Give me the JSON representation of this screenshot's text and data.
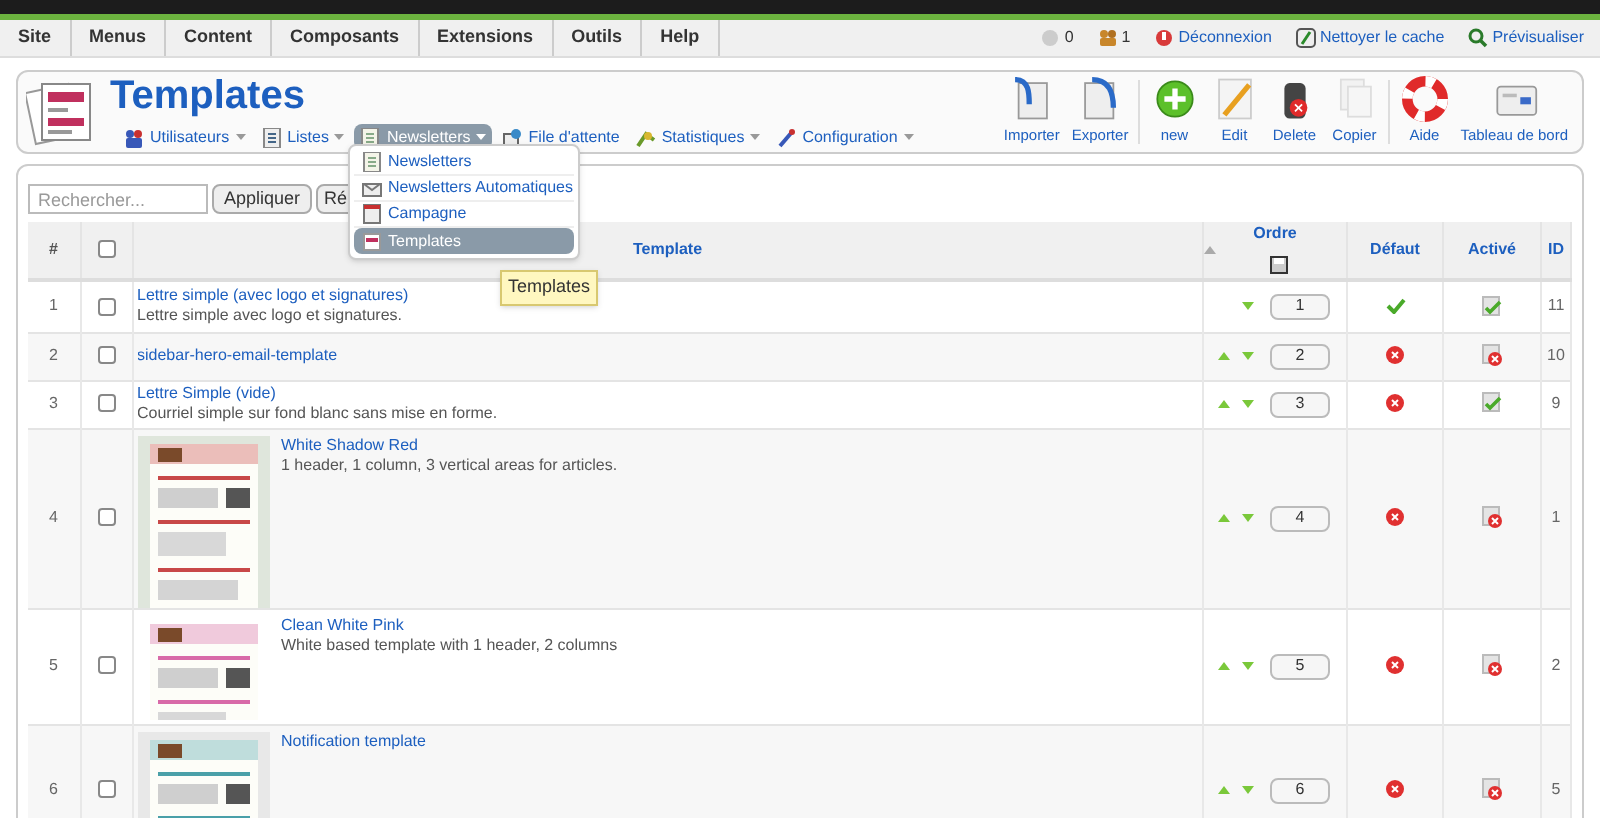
{
  "menu_bar": {
    "items": [
      "Site",
      "Menus",
      "Content",
      "Composants",
      "Extensions",
      "Outils",
      "Help"
    ]
  },
  "status": [
    {
      "kind": "messages",
      "label": "0"
    },
    {
      "kind": "users",
      "label": "1"
    },
    {
      "kind": "logout",
      "label": "Déconnexion"
    },
    {
      "kind": "cache",
      "label": "Nettoyer le cache"
    },
    {
      "kind": "preview",
      "label": "Prévisualiser"
    }
  ],
  "page_title": "Templates",
  "submenu": [
    {
      "kind": "users",
      "label": "Utilisateurs",
      "has_dropdown": true,
      "selected": false
    },
    {
      "kind": "lists",
      "label": "Listes",
      "has_dropdown": true,
      "selected": false
    },
    {
      "kind": "newsletters",
      "label": "Newsletters",
      "has_dropdown": true,
      "selected": true
    },
    {
      "kind": "queue",
      "label": "File d'attente",
      "has_dropdown": false,
      "selected": false
    },
    {
      "kind": "stats",
      "label": "Statistiques",
      "has_dropdown": true,
      "selected": false
    },
    {
      "kind": "config",
      "label": "Configuration",
      "has_dropdown": true,
      "selected": false
    }
  ],
  "dropdown": [
    {
      "kind": "newsletters",
      "label": "Newsletters",
      "selected": false
    },
    {
      "kind": "auto",
      "label": "Newsletters Automatiques",
      "selected": false
    },
    {
      "kind": "campaign",
      "label": "Campagne",
      "selected": false
    },
    {
      "kind": "templates",
      "label": "Templates",
      "selected": true
    }
  ],
  "tooltip": "Templates",
  "toolbar": [
    {
      "kind": "import",
      "label": "Importer",
      "disabled": false
    },
    {
      "kind": "export",
      "label": "Exporter",
      "disabled": false
    },
    {
      "kind": "new",
      "label": "new",
      "disabled": false
    },
    {
      "kind": "edit",
      "label": "Edit",
      "disabled": false
    },
    {
      "kind": "delete",
      "label": "Delete",
      "disabled": false
    },
    {
      "kind": "copy",
      "label": "Copier",
      "disabled": false
    },
    {
      "kind": "help",
      "label": "Aide",
      "disabled": false
    },
    {
      "kind": "dashboard",
      "label": "Tableau de bord",
      "disabled": false
    }
  ],
  "filter": {
    "placeholder": "Rechercher...",
    "apply": "Appliquer",
    "reset": "Ré"
  },
  "table": {
    "columns": [
      "#",
      "Template",
      "Ordre",
      "Défaut",
      "Activé",
      "ID"
    ],
    "select_all_checked": false,
    "rows": [
      {
        "number": "1",
        "title": "Lettre simple (avec logo et signatures)",
        "description": "Lettre simple avec logo et signatures.",
        "checked": false,
        "can_move_up": false,
        "can_move_down": true,
        "order": "1",
        "default": true,
        "active": true,
        "id": "11"
      },
      {
        "number": "2",
        "title": "sidebar-hero-email-template",
        "checked": false,
        "can_move_up": true,
        "can_move_down": true,
        "order": "2",
        "default": false,
        "active": false,
        "id": "10"
      },
      {
        "number": "3",
        "title": "Lettre Simple (vide)",
        "description": "Courriel simple sur fond blanc sans mise en forme.",
        "checked": false,
        "can_move_up": true,
        "can_move_down": true,
        "order": "3",
        "default": false,
        "active": true,
        "id": "9"
      },
      {
        "number": "4",
        "title": "White Shadow Red",
        "description": "1 header, 1 column, 3 vertical areas for articles.",
        "checked": false,
        "can_move_up": true,
        "can_move_down": true,
        "order": "4",
        "default": false,
        "active": false,
        "id": "1"
      },
      {
        "number": "5",
        "title": "Clean White Pink",
        "description": "White based template with 1 header, 2 columns",
        "checked": false,
        "can_move_up": true,
        "can_move_down": true,
        "order": "5",
        "default": false,
        "active": false,
        "id": "2"
      },
      {
        "number": "6",
        "title": "Notification template",
        "checked": false,
        "can_move_up": true,
        "can_move_down": true,
        "order": "6",
        "default": false,
        "active": false,
        "id": "5"
      }
    ]
  }
}
